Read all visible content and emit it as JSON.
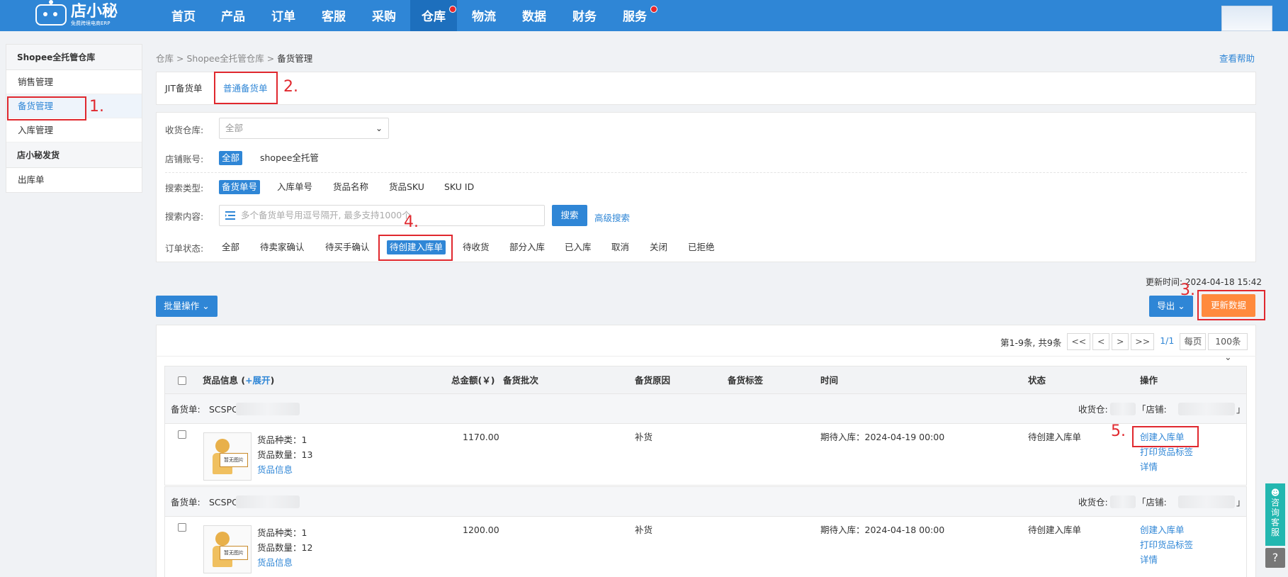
{
  "nav": {
    "logo_main": "店小秘",
    "logo_sub": "免费跨境电商ERP",
    "items": [
      "首页",
      "产品",
      "订单",
      "客服",
      "采购",
      "仓库",
      "物流",
      "数据",
      "财务",
      "服务"
    ]
  },
  "sidebar": {
    "section1": "Shopee全托管仓库",
    "items1": [
      "销售管理",
      "备货管理",
      "入库管理"
    ],
    "section2": "店小秘发货",
    "items2": [
      "出库单"
    ]
  },
  "breadcrumb": {
    "part1": "仓库",
    "sep": ">",
    "part2": "Shopee全托管仓库",
    "current": "备货管理"
  },
  "help_link": "查看帮助",
  "tabs": [
    "JIT备货单",
    "普通备货单"
  ],
  "filters": {
    "warehouse_label": "收货仓库:",
    "warehouse_value": "全部",
    "shop_label": "店铺账号:",
    "shop_options": [
      "全部",
      "shopee全托管"
    ],
    "search_type_label": "搜索类型:",
    "search_types": [
      "备货单号",
      "入库单号",
      "货品名称",
      "货品SKU",
      "SKU ID"
    ],
    "search_content_label": "搜索内容:",
    "search_placeholder": "多个备货单号用逗号隔开, 最多支持1000个",
    "search_button": "搜索",
    "advanced_search": "高级搜索",
    "status_label": "订单状态:",
    "statuses": [
      "全部",
      "待卖家确认",
      "待买手确认",
      "待创建入库单",
      "待收货",
      "部分入库",
      "已入库",
      "取消",
      "关闭",
      "已拒绝"
    ]
  },
  "update_time": "更新时间: 2024-04-18 15:42",
  "batch_button": "批量操作",
  "export_button": "导出",
  "refresh_button": "更新数据",
  "pager": {
    "summary": "第1-9条, 共9条",
    "first": "<<",
    "prev": "<",
    "next": ">",
    "last": ">>",
    "page": "1/1",
    "per_page_label": "每页",
    "per_page": "100条"
  },
  "table": {
    "headers": {
      "goods": "货品信息 (",
      "expand": "+展开",
      "goods_end": ")",
      "amount": "总金额(￥)",
      "batch": "备货批次",
      "reason": "备货原因",
      "tag": "备货标签",
      "time": "时间",
      "status": "状态",
      "ops": "操作"
    },
    "groups": [
      {
        "order_label": "备货单:",
        "order_prefix": "SCSPC",
        "warehouse_label": "收货仓:",
        "shop_label": "「店铺:",
        "shop_end": "」",
        "kinds": "货品种类：1",
        "qty": "货品数量：13",
        "info_link": "货品信息",
        "thumb_text": "暂无图片",
        "amount": "1170.00",
        "reason": "补货",
        "time": "期待入库：2024-04-19 00:00",
        "status": "待创建入库单",
        "ops": [
          "创建入库单",
          "打印货品标签",
          "详情"
        ]
      },
      {
        "order_label": "备货单:",
        "order_prefix": "SCSPC",
        "warehouse_label": "收货仓:",
        "shop_label": "「店铺:",
        "shop_end": "」",
        "kinds": "货品种类：1",
        "qty": "货品数量：12",
        "info_link": "货品信息",
        "thumb_text": "暂无图片",
        "amount": "1200.00",
        "reason": "补货",
        "time": "期待入库：2024-04-18 00:00",
        "status": "待创建入库单",
        "ops": [
          "创建入库单",
          "打印货品标签",
          "详情"
        ]
      }
    ]
  },
  "annotations": [
    "1.",
    "2.",
    "3.",
    "4.",
    "5."
  ],
  "float": {
    "service": "咨询客服",
    "help": "?"
  },
  "colors": {
    "nav": "#2f86d6",
    "accent": "#2f86d6",
    "orange": "#ff8a3d",
    "annotation": "#e0282e"
  }
}
